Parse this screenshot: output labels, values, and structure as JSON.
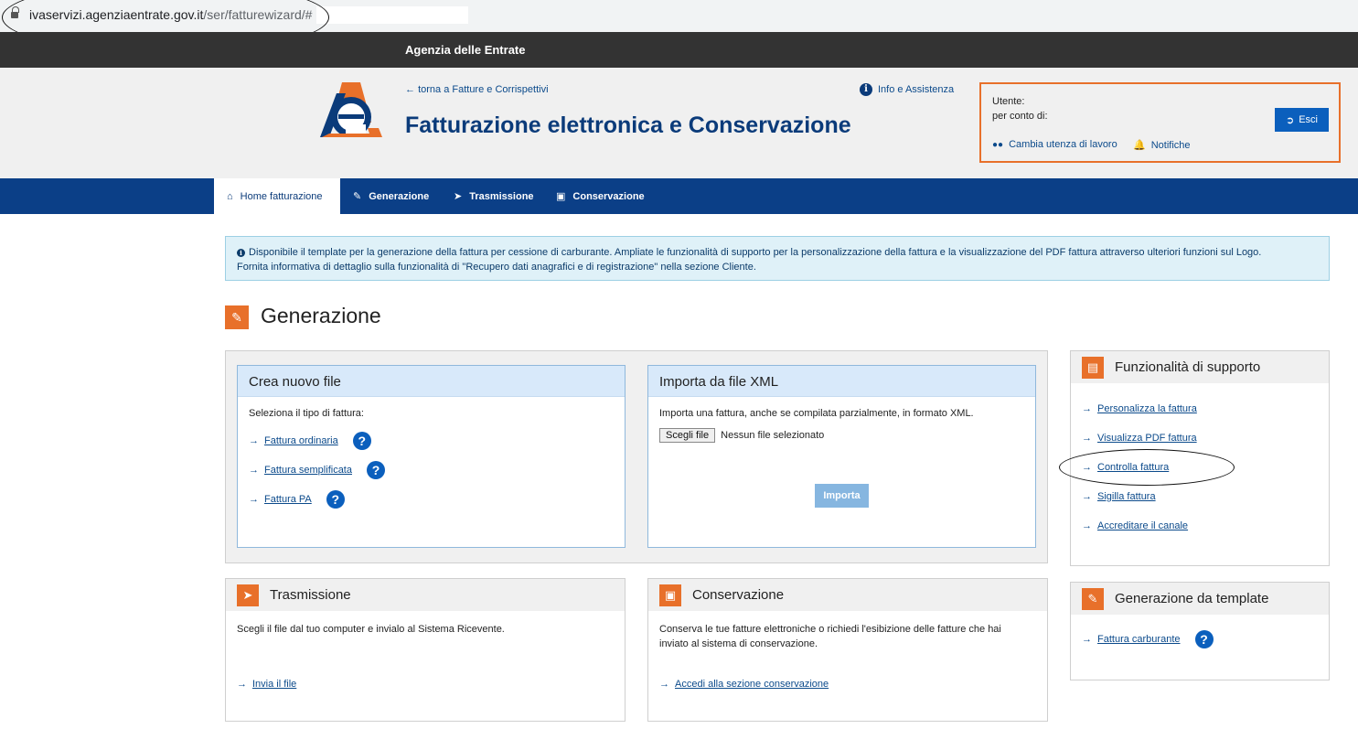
{
  "browser": {
    "url_host": "ivaservizi.agenziaentrate.gov.it",
    "url_path": "/ser/fatturewizard/#"
  },
  "topbar": {
    "title": "Agenzia delle Entrate"
  },
  "header": {
    "back_link": "torna a Fatture e Corrispettivi",
    "app_title": "Fatturazione elettronica e Conservazione",
    "info_link": "Info e Assistenza",
    "user_label": "Utente:",
    "behalf_label": "per conto di:",
    "logout_label": "Esci",
    "change_user": "Cambia utenza di lavoro",
    "notifications": "Notifiche"
  },
  "nav": {
    "items": [
      {
        "label": "Home fatturazione",
        "icon": "home-icon"
      },
      {
        "label": "Generazione",
        "icon": "pencil-icon"
      },
      {
        "label": "Trasmissione",
        "icon": "paper-plane-icon"
      },
      {
        "label": "Conservazione",
        "icon": "archive-icon"
      }
    ]
  },
  "alert": {
    "line1": "Disponibile il template per la generazione della fattura per cessione di carburante. Ampliate le funzionalità di supporto per la personalizzazione della fattura e la visualizzazione del PDF fattura attraverso ulteriori funzioni sul Logo.",
    "line2": "Fornita informativa di dettaglio sulla funzionalità di \"Recupero dati anagrafici e di registrazione\" nella sezione Cliente."
  },
  "section": {
    "title": "Generazione"
  },
  "crea": {
    "title": "Crea nuovo file",
    "prompt": "Seleziona il tipo di fattura:",
    "links": [
      "Fattura ordinaria",
      "Fattura semplificata",
      "Fattura PA"
    ]
  },
  "importa": {
    "title": "Importa da file XML",
    "desc": "Importa una fattura, anche se compilata parzialmente, in formato XML.",
    "choose_file": "Scegli file",
    "no_file": "Nessun file selezionato",
    "import_btn": "Importa"
  },
  "trasmissione": {
    "title": "Trasmissione",
    "desc": "Scegli il file dal tuo computer e invialo al Sistema Ricevente.",
    "link": "Invia il file"
  },
  "conservazione": {
    "title": "Conservazione",
    "desc1": "Conserva le tue fatture elettroniche o richiedi l'esibizione delle fatture che hai",
    "desc2": "inviato al sistema di conservazione.",
    "link": "Accedi alla sezione conservazione"
  },
  "supporto": {
    "title": "Funzionalità di supporto",
    "links": [
      "Personalizza la fattura",
      "Visualizza PDF fattura",
      "Controlla fattura",
      "Sigilla fattura",
      "Accreditare il canale"
    ]
  },
  "template": {
    "title": "Generazione da template",
    "link": "Fattura carburante"
  },
  "colors": {
    "brand_blue": "#0b3f87",
    "accent_orange": "#e8702a",
    "link_blue": "#0b4a8b"
  }
}
